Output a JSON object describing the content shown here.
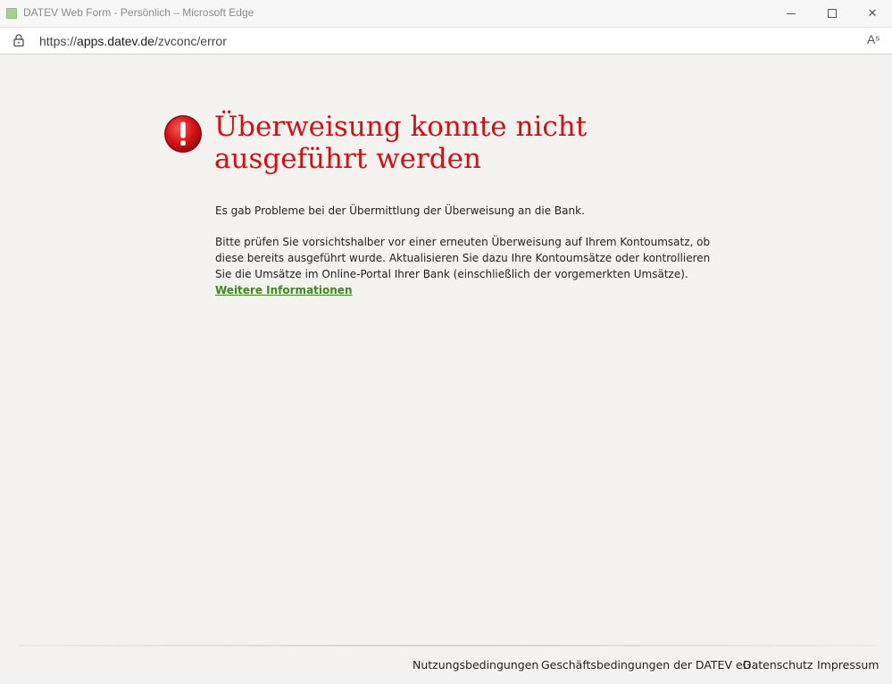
{
  "window": {
    "title": "DATEV Web Form - Persönlich – Microsoft Edge",
    "minimize_icon": "minimize-icon",
    "maximize_icon": "maximize-icon",
    "close_glyph": "✕"
  },
  "address": {
    "prefix": "https://",
    "host": "apps.datev.de",
    "path": "/zvconc/error",
    "read_aloud_glyph": "Aˢ"
  },
  "error": {
    "icon": "exclamation-icon",
    "headline": "Überweisung konnte nicht ausgeführt werden",
    "paragraph1": "Es gab Probleme bei der Übermittlung der Überweisung an die Bank.",
    "paragraph2": "Bitte prüfen Sie vorsichtshalber vor einer erneuten Überweisung auf Ihrem Kontoumsatz, ob diese bereits ausgeführt wurde. Aktualisieren Sie dazu Ihre Kontoumsätze oder kontrollieren Sie die Umsätze im Online-Portal Ihrer Bank (einschließlich der vorgemerkten Umsätze).",
    "more_link": "Weitere Informationen"
  },
  "footer": {
    "links": [
      "Nutzungsbedingungen",
      "Geschäftsbedingungen der DATEV eG",
      "Datenschutz",
      "Impressum"
    ]
  },
  "colors": {
    "headline": "#d40f14",
    "link": "#3b8a1e",
    "background": "#f3f2ef"
  }
}
